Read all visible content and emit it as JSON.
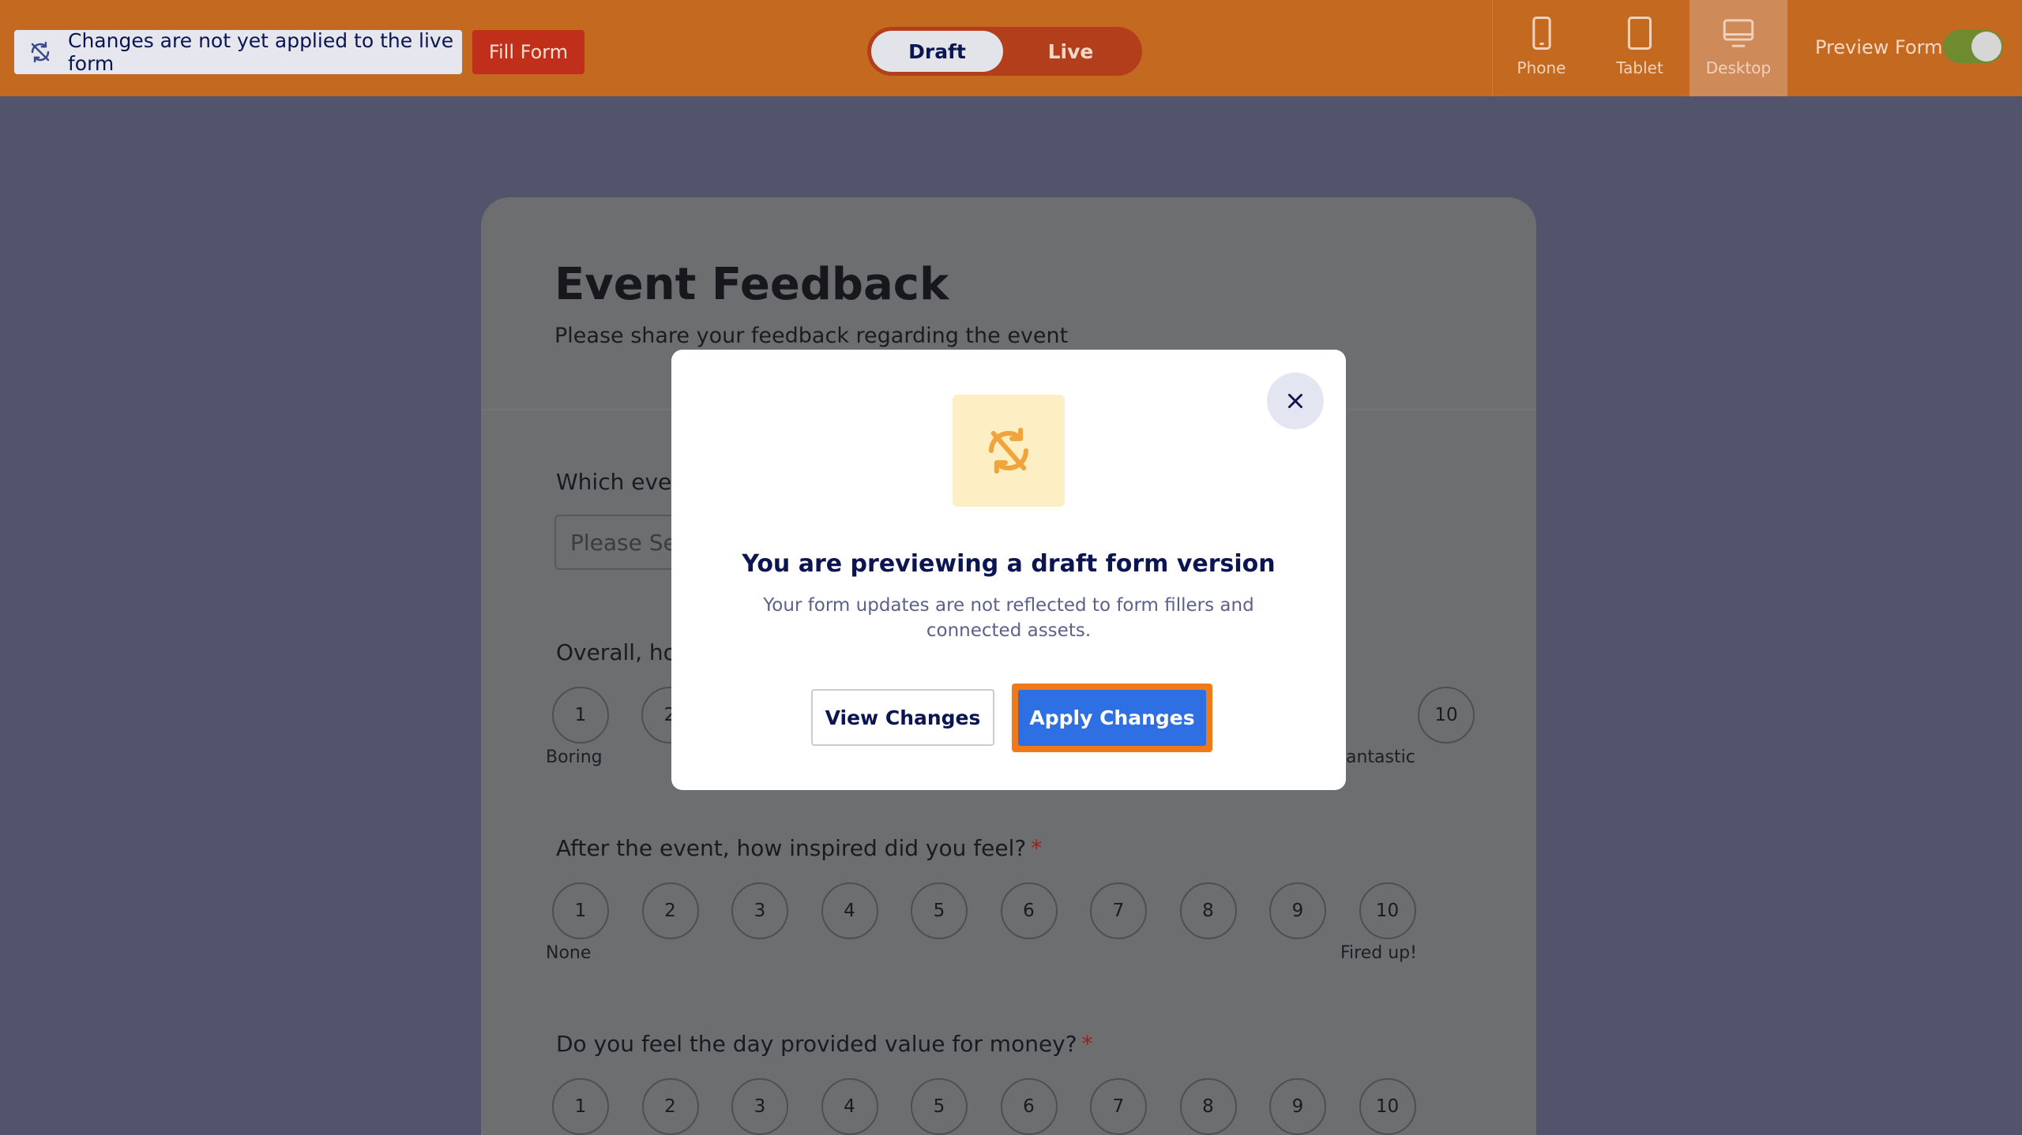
{
  "topbar": {
    "notice_text": "Changes are not yet applied to the live form",
    "fill_form_label": "Fill Form",
    "mode_draft_label": "Draft",
    "mode_live_label": "Live",
    "devices": {
      "phone": "Phone",
      "tablet": "Tablet",
      "desktop": "Desktop"
    },
    "selected_device": "Desktop",
    "preview_form_label": "Preview Form",
    "preview_form_enabled": true
  },
  "form": {
    "title": "Event Feedback",
    "subtitle": "Please share your feedback regarding the event",
    "q1": {
      "label": "Which even",
      "placeholder": "Please Se"
    },
    "q2": {
      "label": "Overall, ho",
      "visible_left": [
        "1",
        "2"
      ],
      "visible_right": "10",
      "min_caption": "Boring",
      "max_caption": "antastic"
    },
    "q3": {
      "label": "After the event, how inspired did you feel?",
      "required": "*",
      "scale": [
        "1",
        "2",
        "3",
        "4",
        "5",
        "6",
        "7",
        "8",
        "9",
        "10"
      ],
      "min_caption": "None",
      "max_caption": "Fired up!"
    },
    "q4": {
      "label": "Do you feel the day provided value for money?",
      "required": "*",
      "scale": [
        "1",
        "2",
        "3",
        "4",
        "5",
        "6",
        "7",
        "8",
        "9",
        "10"
      ]
    }
  },
  "modal": {
    "title": "You are previewing a draft form version",
    "text": "Your form updates are not reflected to form fillers and connected assets.",
    "view_changes_label": "View Changes",
    "apply_changes_label": "Apply Changes"
  },
  "colors": {
    "topbar_bg": "#c46a20",
    "overlay_bg": "#52546b",
    "accent_blue": "#2f6fe4",
    "highlight_orange": "#f07a17",
    "navy_text": "#0a1551"
  }
}
